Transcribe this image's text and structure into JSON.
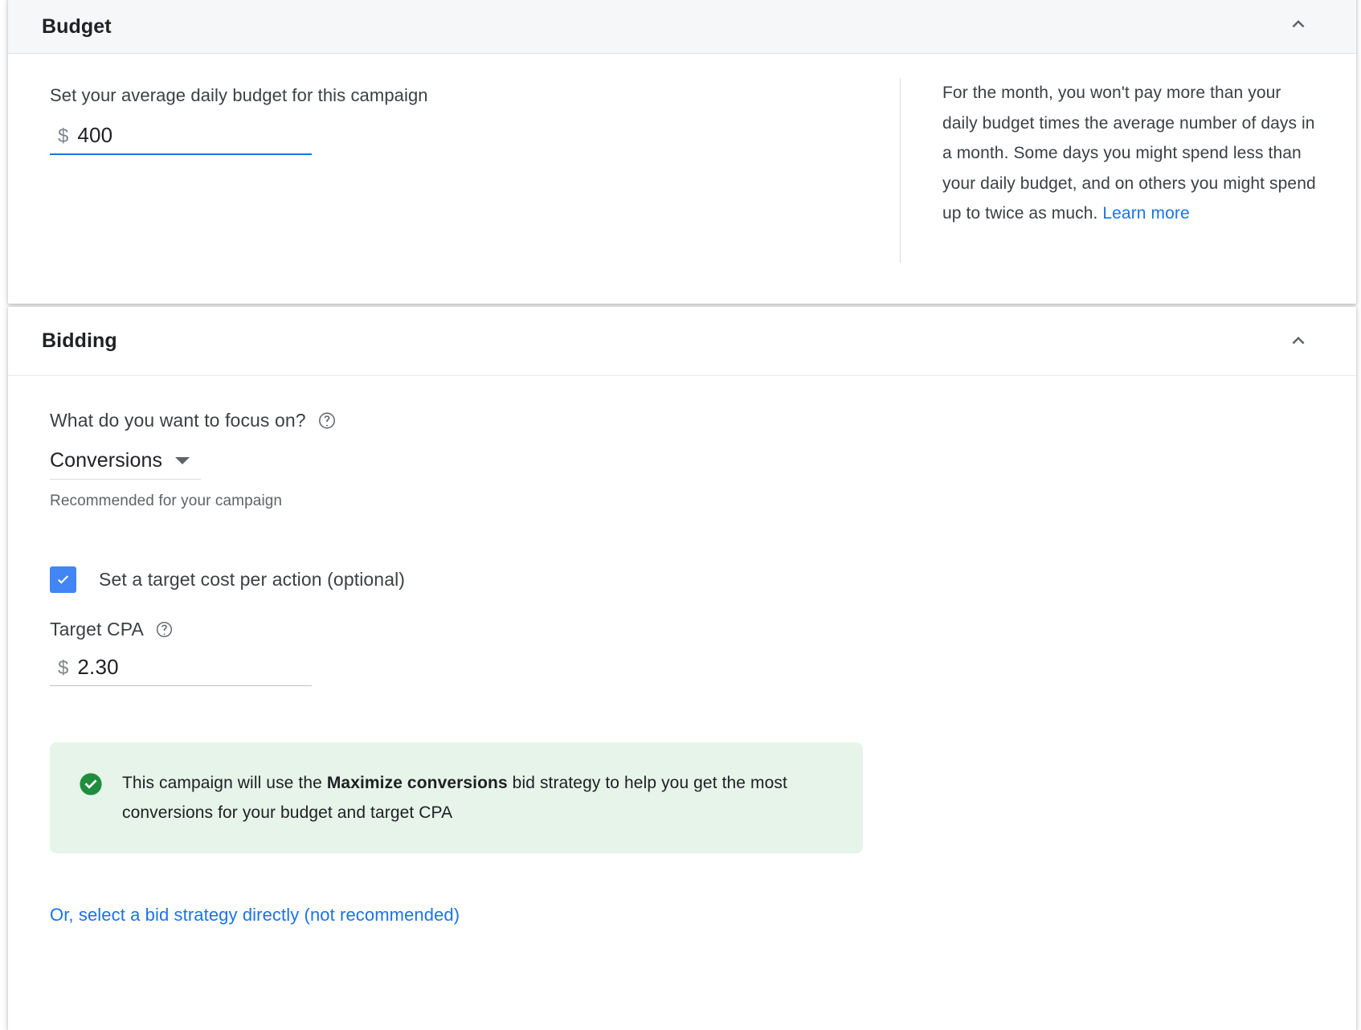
{
  "colors": {
    "accent_blue": "#1a73e8",
    "checkbox_blue": "#4285f4",
    "notice_bg": "#e6f4ea",
    "notice_icon": "#1e8e3e",
    "header_bg": "#f6f7f8",
    "text_primary": "#202124",
    "text_secondary": "#3c4043",
    "text_muted": "#5f6368"
  },
  "budget": {
    "title": "Budget",
    "collapse_icon": "chevron-up-icon",
    "field_label": "Set your average daily budget for this campaign",
    "currency_symbol": "$",
    "amount": "400",
    "info_text": "For the month, you won't pay more than your daily budget times the average number of days in a month. Some days you might spend less than your daily budget, and on others you might spend up to twice as much. ",
    "learn_more": "Learn more"
  },
  "bidding": {
    "title": "Bidding",
    "collapse_icon": "chevron-up-icon",
    "focus_question": "What do you want to focus on?",
    "focus_help_icon": "help-circle-icon",
    "focus_value": "Conversions",
    "focus_caret_icon": "chevron-down-icon",
    "focus_helper": "Recommended for your campaign",
    "target_cpa_checkbox_label": "Set a target cost per action (optional)",
    "target_cpa_checkbox_checked": true,
    "target_cpa_label": "Target CPA",
    "target_cpa_help_icon": "help-circle-icon",
    "target_cpa_currency": "$",
    "target_cpa_value": "2.30",
    "notice_icon": "check-circle-icon",
    "notice_part1": "This campaign will use the ",
    "notice_strategy": "Maximize conversions",
    "notice_part2": " bid strategy to help you get the most conversions for your budget and target CPA",
    "bottom_link": "Or, select a bid strategy directly (not recommended)"
  }
}
